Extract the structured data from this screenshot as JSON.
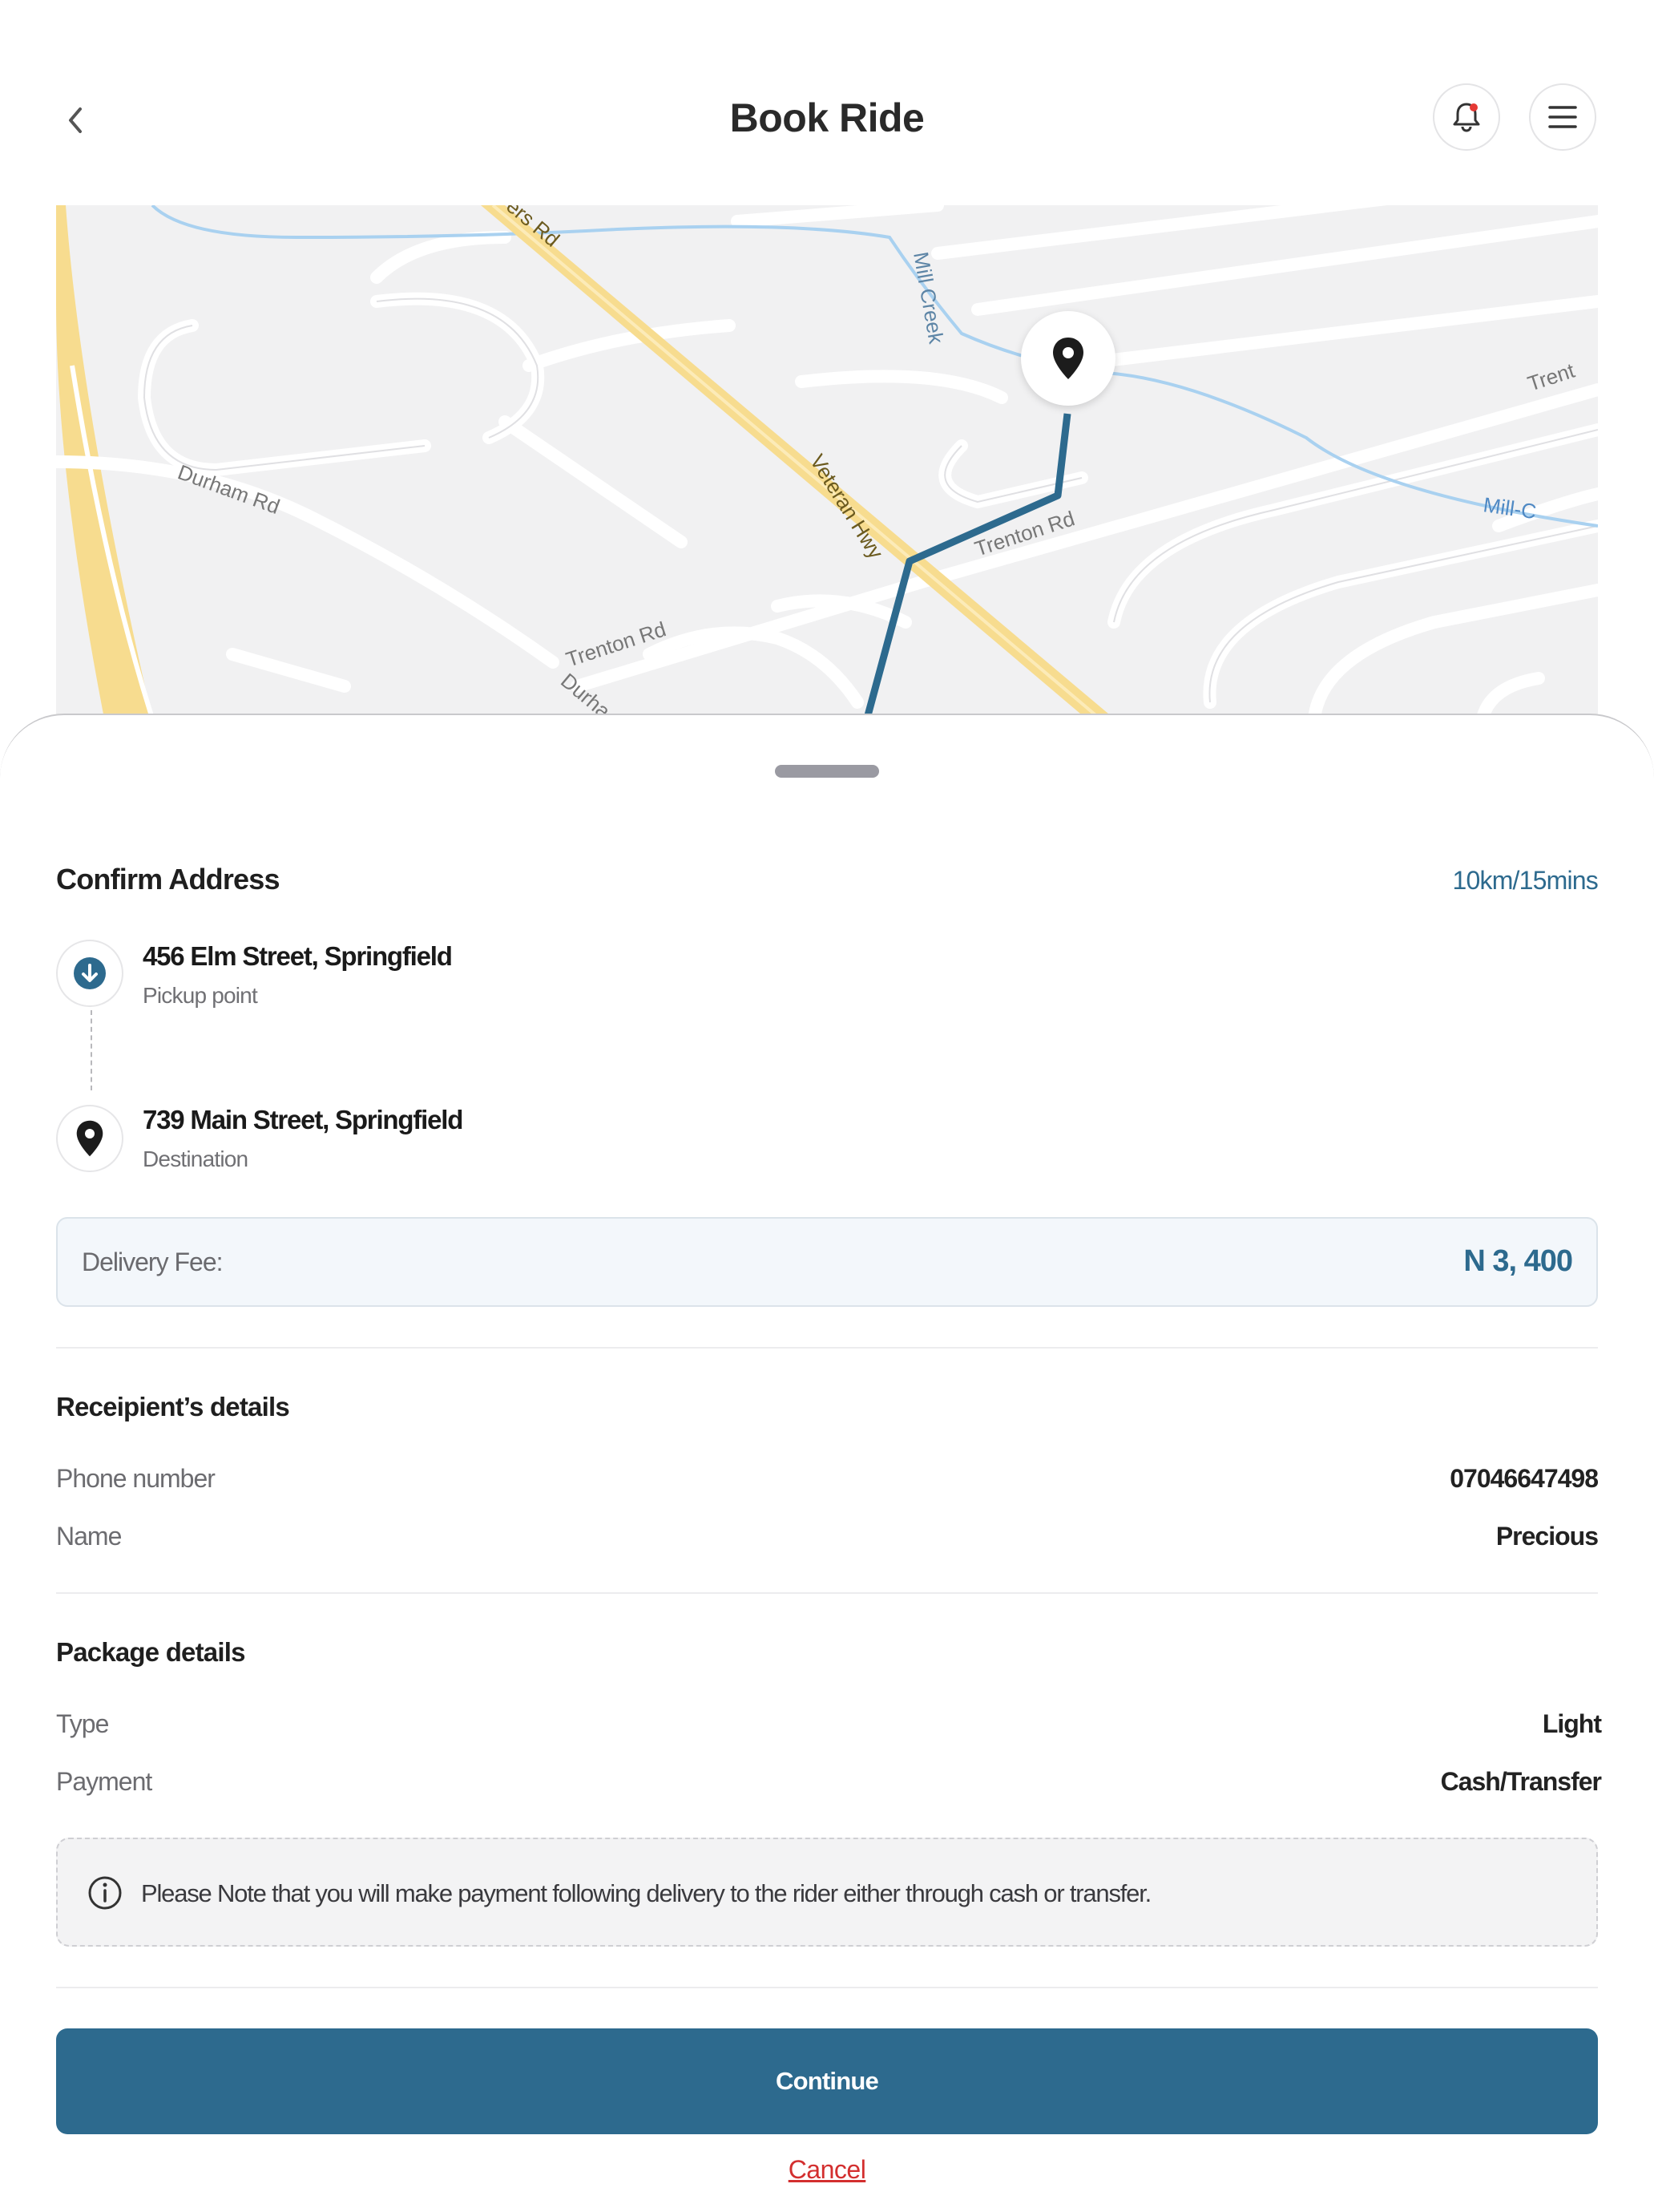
{
  "header": {
    "title": "Book Ride",
    "back_icon": "chevron-left-icon",
    "notification_icon": "bell-icon",
    "menu_icon": "hamburger-menu-icon"
  },
  "map": {
    "street_labels": [
      "Durham Rd",
      "Trenton Rd",
      "Trenton Rd",
      "Veteran Hwy",
      "Mill Creek",
      "Mill-C",
      "Trent",
      "ers Rd",
      "Durha"
    ],
    "destination_marker_icon": "location-pin-icon",
    "route_color": "#2d6a8e"
  },
  "sheet": {
    "confirm_title": "Confirm Address",
    "distance_eta": "10km/15mins",
    "pickup": {
      "address": "456 Elm Street, Springfield",
      "label": "Pickup point",
      "icon": "arrow-down-circle-icon"
    },
    "destination": {
      "address": "739 Main Street, Springfield",
      "label": "Destination",
      "icon": "location-pin-icon"
    },
    "fee": {
      "label": "Delivery Fee:",
      "value": "N 3, 400"
    },
    "recipient": {
      "title": "Receipient’s details",
      "rows": [
        {
          "label": "Phone number",
          "value": "07046647498"
        },
        {
          "label": "Name",
          "value": "Precious"
        }
      ]
    },
    "package": {
      "title": "Package details",
      "rows": [
        {
          "label": "Type",
          "value": "Light"
        },
        {
          "label": "Payment",
          "value": "Cash/Transfer"
        }
      ]
    },
    "note": {
      "icon": "info-icon",
      "text": "Please Note that you will make payment following delivery to the rider either through cash or transfer."
    },
    "continue_label": "Continue",
    "cancel_label": "Cancel"
  },
  "colors": {
    "accent": "#2d6a8e",
    "danger": "#d32f2f",
    "fee_bg": "#f3f7fb"
  }
}
